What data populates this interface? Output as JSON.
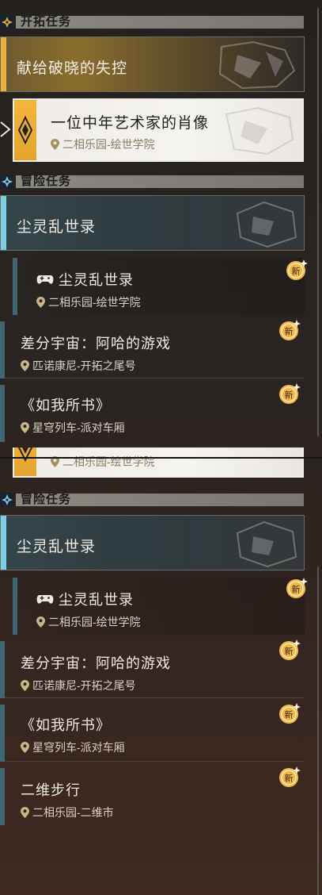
{
  "sections": {
    "trailblaze_label": "开拓任务",
    "adventure_label": "冒险任务"
  },
  "trailblaze": {
    "main_title": "献给破晓的失控",
    "selected": {
      "title": "一位中年艺术家的肖像",
      "location": "二相乐园-绘世学院"
    }
  },
  "adventure": {
    "main_title": "尘灵乱世录",
    "quests": [
      {
        "title": "尘灵乱世录",
        "location": "二相乐园-绘世学院",
        "badge": "新"
      },
      {
        "title": "差分宇宙：阿哈的游戏",
        "location": "匹诺康尼-开拓之尾号",
        "badge": "新"
      },
      {
        "title": "《如我所书》",
        "location": "星穹列车-派对车厢",
        "badge": "新"
      },
      {
        "title": "二维步行",
        "location": "二相乐园-二维市",
        "badge": "新"
      }
    ]
  },
  "colors": {
    "gold": "#e8b13c",
    "teal": "#7ad0e2",
    "badge": "#f0b94a"
  },
  "icons": [
    "diamond-quest-icon",
    "location-pin-icon",
    "new-badge-icon",
    "game-controller-icon",
    "selection-arrow-icon"
  ]
}
